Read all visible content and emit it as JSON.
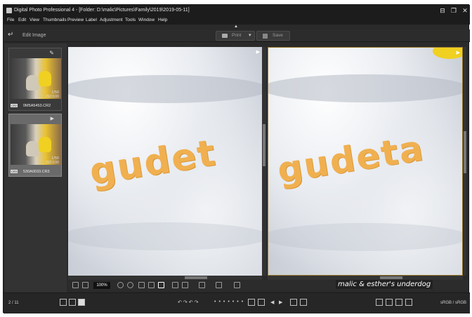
{
  "window": {
    "title": "Digital Photo Professional 4 - [Folder: D:\\malic\\Pictures\\Family\\2019\\2019-05-11]",
    "minimize_glyph": "⊟",
    "maximize_glyph": "❐",
    "close_glyph": "✕"
  },
  "menu": [
    "File",
    "Edit",
    "View",
    "Thumbnails",
    "Preview",
    "Label",
    "Adjustment",
    "Tools",
    "Window",
    "Help"
  ],
  "toolbar": {
    "back_glyph": "↵",
    "edit_image_label": "Edit Image",
    "print_label": "Print",
    "save_label": "Save",
    "collapse_glyph": "▲"
  },
  "filmstrip": {
    "items": [
      {
        "meta_line1": "1/50",
        "meta_line2": "ISO100",
        "filename": "0M5A5453.CR2",
        "badge": "CR2"
      },
      {
        "meta_line1": "1/50",
        "meta_line2": "ISO100",
        "filename": "530A0033.CR3",
        "badge": "CR3"
      }
    ]
  },
  "views": {
    "left_text": "gudet",
    "right_text": "gudeta"
  },
  "zoom": {
    "value": "100%"
  },
  "status": {
    "page_count": "2 / 11",
    "profile": "sRGB / sRGB"
  },
  "watermark": "malic & esther's underdog",
  "colors": {
    "window_bg": "#2a2a2a",
    "titlebar_bg": "#1c1c1c",
    "selection_border": "#9a7a30",
    "letter_orange": "#f0b050",
    "toy_yellow": "#f0d020"
  }
}
